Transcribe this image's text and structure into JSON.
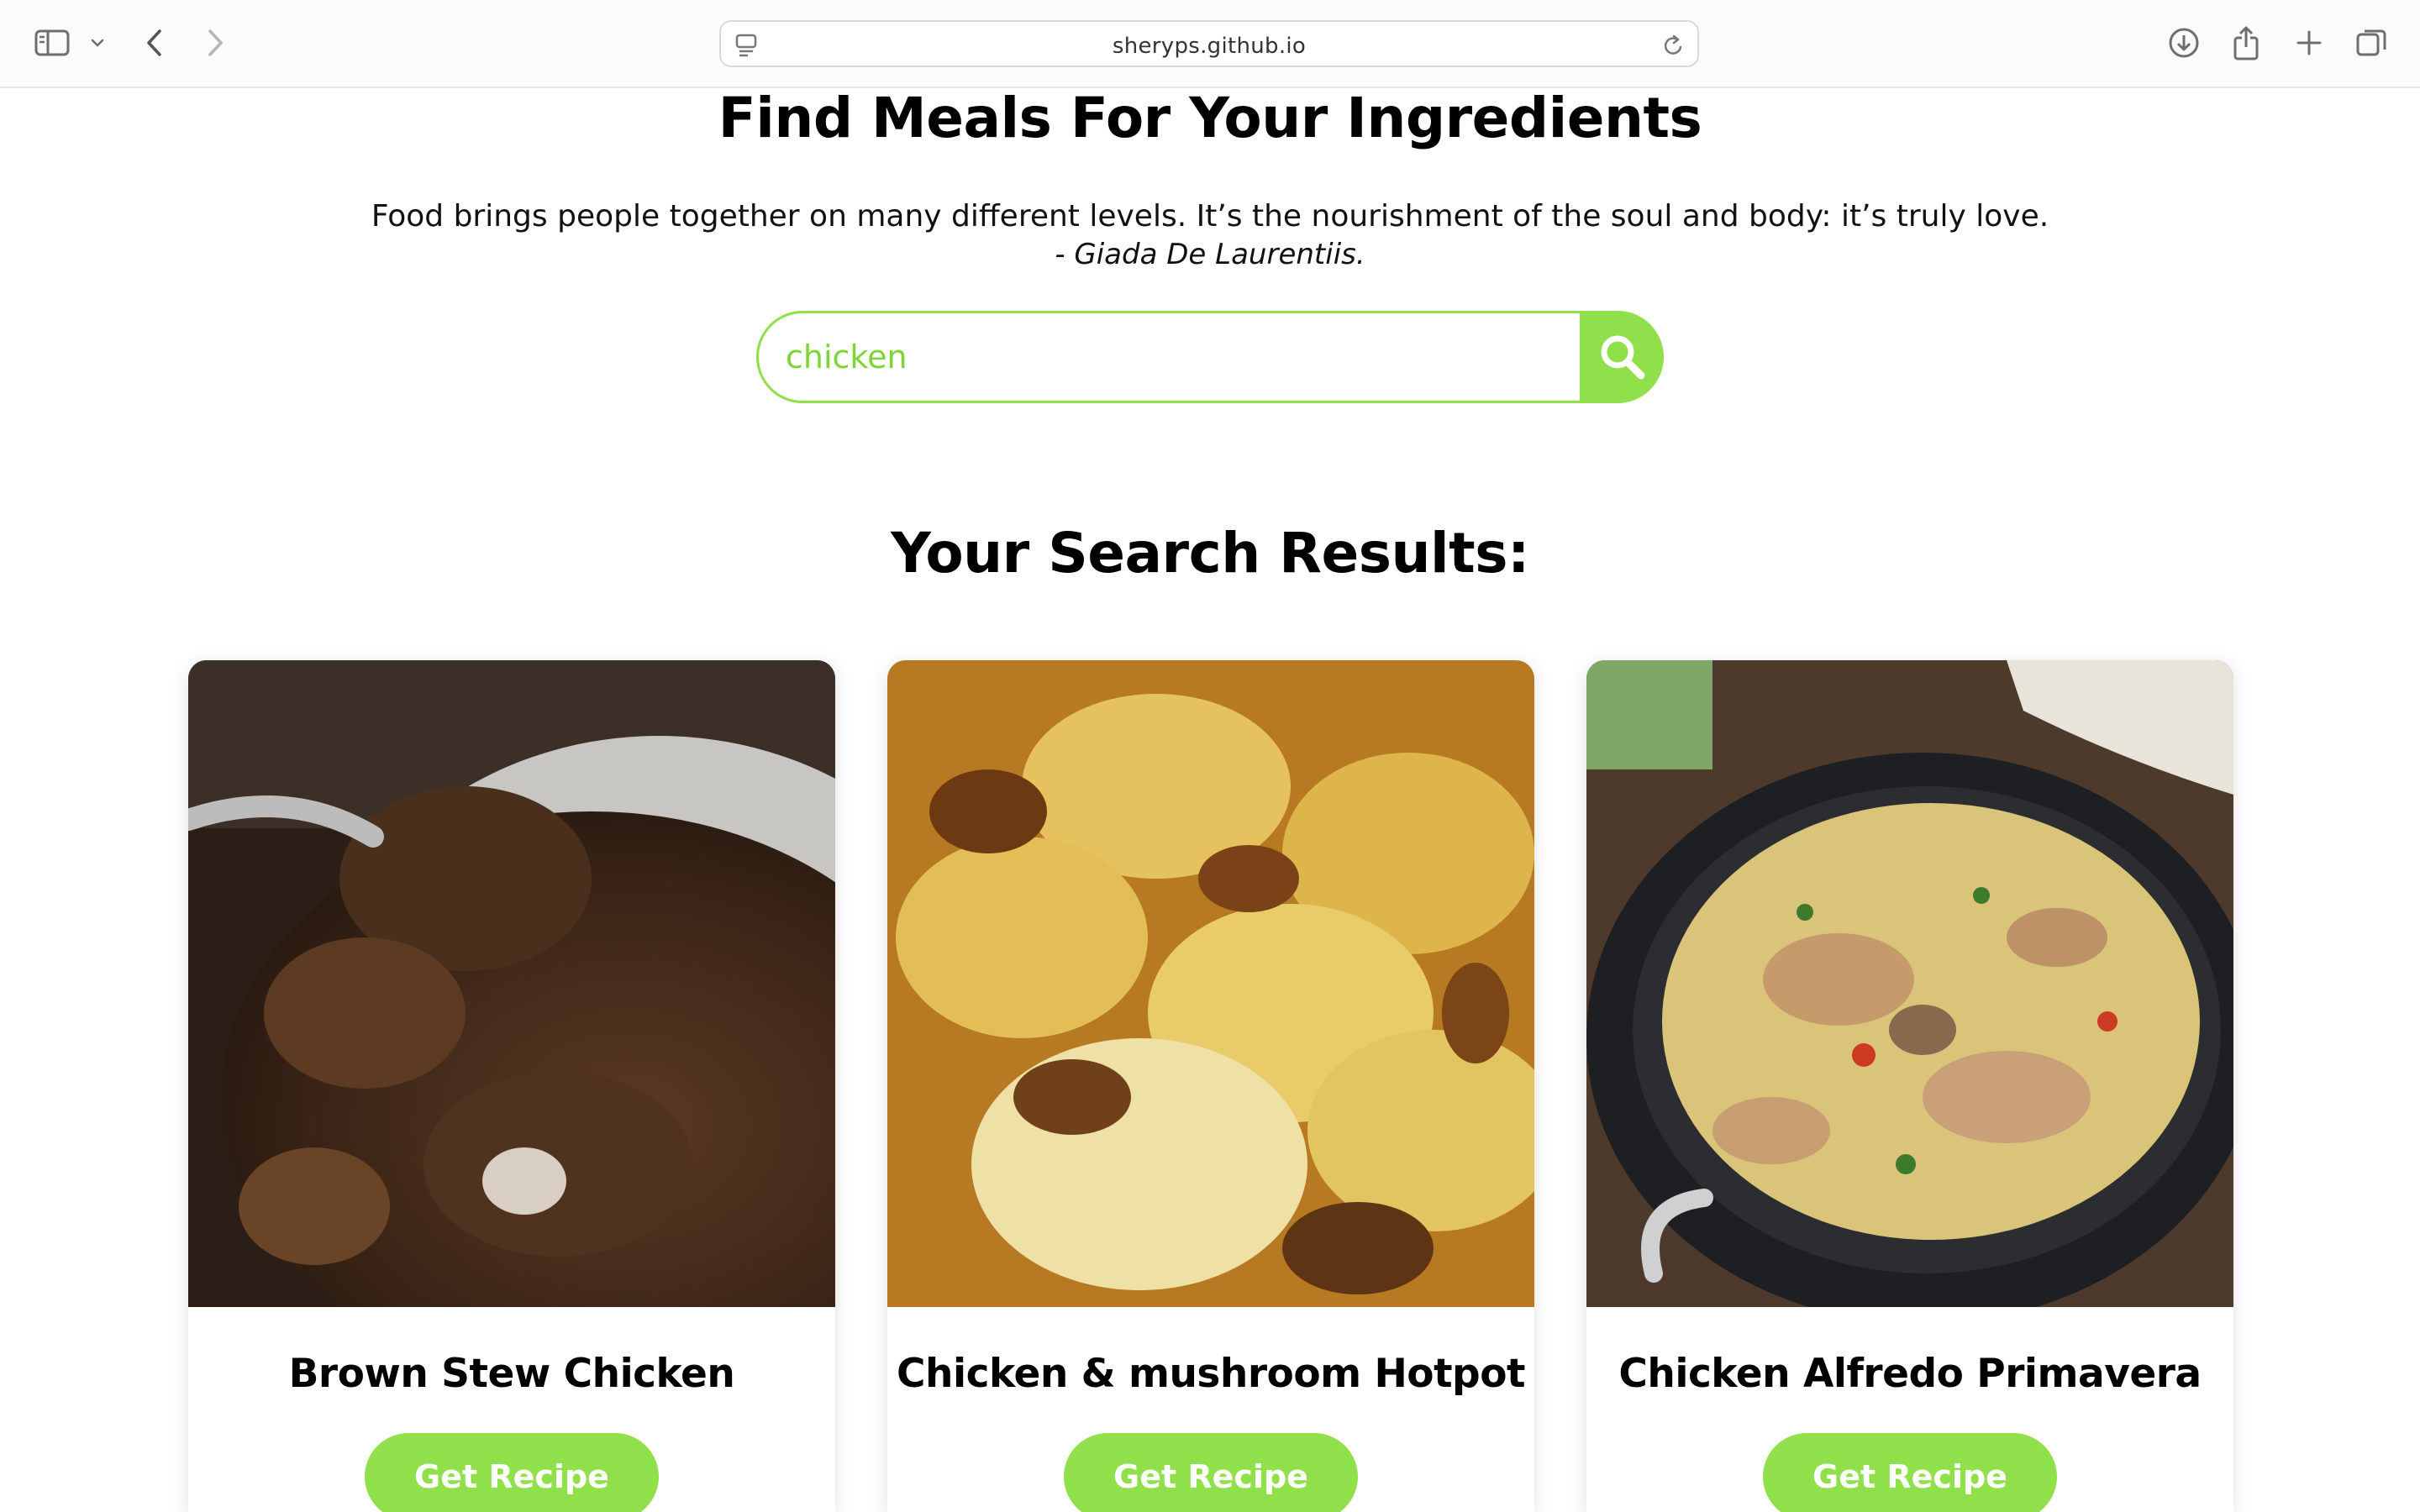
{
  "browser": {
    "url": "sheryps.github.io",
    "icons": [
      "sidebar-icon",
      "chevron-down-icon",
      "back-icon",
      "forward-icon",
      "site-settings-icon",
      "reload-icon",
      "download-icon",
      "share-icon",
      "new-tab-icon",
      "tabs-overview-icon"
    ]
  },
  "page": {
    "title": "Find Meals For Your Ingredients",
    "quote": "Food brings people together on many different levels. It’s the nourishment of the soul and body: it’s truly love.",
    "quote_author": "- Giada De Laurentiis.",
    "search": {
      "value": "chicken",
      "button_icon": "magnifier-icon"
    },
    "results_title": "Your Search Results:",
    "accent_color": "#8fe04a"
  },
  "results": [
    {
      "title": "Brown Stew Chicken",
      "button_label": "Get Recipe"
    },
    {
      "title": "Chicken & mushroom Hotpot",
      "button_label": "Get Recipe"
    },
    {
      "title": "Chicken Alfredo Primavera",
      "button_label": "Get Recipe"
    }
  ]
}
